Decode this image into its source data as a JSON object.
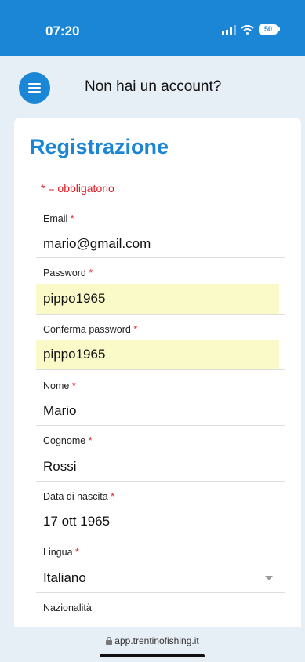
{
  "status_bar": {
    "time": "07:20",
    "battery": "50"
  },
  "header": {
    "title": "Non hai un account?"
  },
  "form": {
    "title": "Registrazione",
    "required_note": "* = obbligatorio",
    "required_marker": "*",
    "fields": {
      "email": {
        "label": "Email",
        "value": "mario@gmail.com"
      },
      "password": {
        "label": "Password",
        "value": "pippo1965"
      },
      "confirm_password": {
        "label": "Conferma password",
        "value": "pippo1965"
      },
      "first_name": {
        "label": "Nome",
        "value": "Mario"
      },
      "last_name": {
        "label": "Cognome",
        "value": "Rossi"
      },
      "birth_date": {
        "label": "Data di nascita",
        "value": "17 ott 1965"
      },
      "language": {
        "label": "Lingua",
        "value": "Italiano"
      },
      "nationality": {
        "label": "Nazionalità"
      }
    }
  },
  "browser": {
    "url": "app.trentinofishing.it"
  },
  "colors": {
    "accent": "#1b86d6",
    "required": "#e01b24",
    "autofill": "#fafac8"
  }
}
